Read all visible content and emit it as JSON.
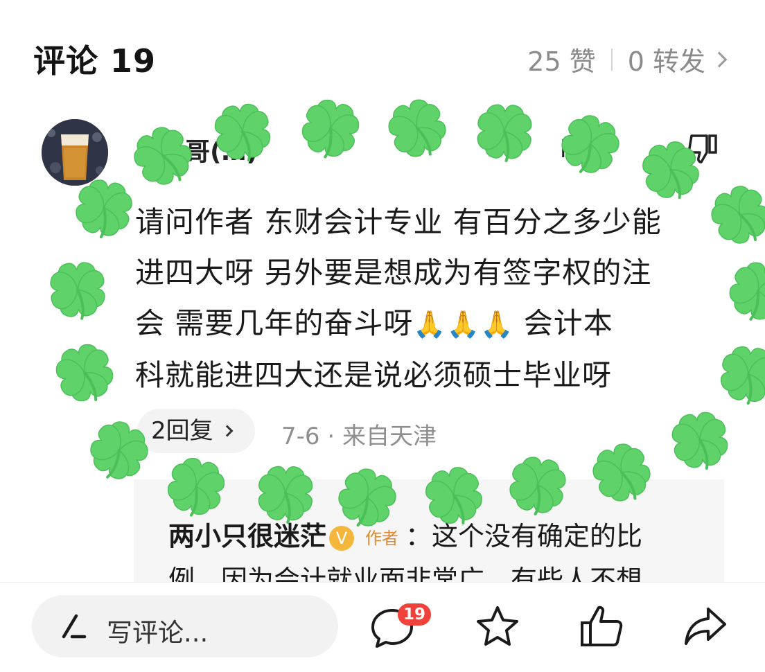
{
  "header": {
    "title": "评论 19",
    "likes": "25 赞",
    "shares": "0 转发"
  },
  "comment": {
    "author": "ヽ…哥(…)",
    "like_label": "ⅰ♪赞",
    "lines": [
      "请问作者 东财会计专业 有百分之多少能",
      "进四大呀 另外要是想成为有签字权的注",
      "会 需要几年的奋斗呀",
      " 会计本",
      "科就能进四大还是说必须硕士毕业呀"
    ],
    "emoji": "🙏",
    "reply_count": "2回复",
    "date": "7-6",
    "location": "· 来自天津"
  },
  "reply": {
    "author": "两小只很迷茫",
    "verified": "V",
    "tag": "作者",
    "text": "：这个没有确定的比例，因为会计就业面非常广，有些人不想"
  },
  "bottom_bar": {
    "placeholder": "写评论...",
    "comment_badge": "19",
    "icons": [
      "pen-icon",
      "comment-icon",
      "star-icon",
      "thumbs-up-icon",
      "share-icon"
    ]
  },
  "colors": {
    "accent_red": "#f0413b",
    "clover_green": "#5fd36a",
    "muted_gray": "#8f8f8f",
    "author_tag_orange": "#e0892e"
  }
}
